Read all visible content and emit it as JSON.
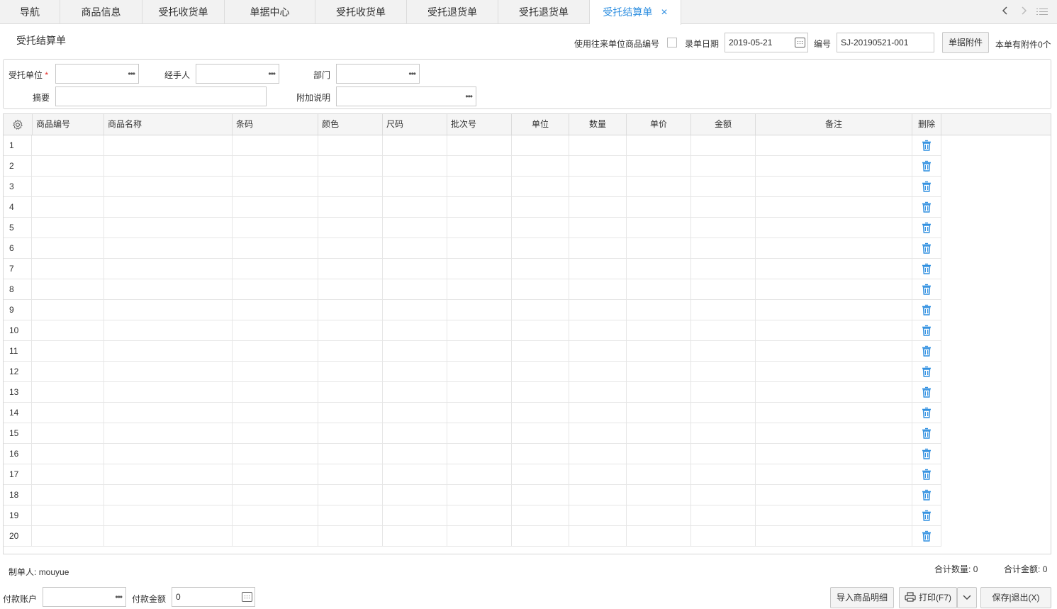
{
  "tabs": [
    {
      "label": "导航",
      "active": false
    },
    {
      "label": "商品信息",
      "active": false
    },
    {
      "label": "受托收货单",
      "active": false
    },
    {
      "label": "单据中心",
      "active": false
    },
    {
      "label": "受托收货单",
      "active": false
    },
    {
      "label": "受托退货单",
      "active": false
    },
    {
      "label": "受托退货单",
      "active": false
    },
    {
      "label": "受托结算单",
      "active": true
    }
  ],
  "tab_nav": {
    "prev_icon": "chevron-left-icon",
    "next_icon": "chevron-right-icon",
    "list_icon": "list-icon",
    "close_icon": "×"
  },
  "page_title": "受托结算单",
  "header": {
    "use_partner_code_label": "使用往来单位商品编号",
    "use_partner_code_checked": false,
    "date_label": "录单日期",
    "date_value": "2019-05-21",
    "number_label": "编号",
    "number_value": "SJ-20190521-001",
    "attachment_button": "单据附件",
    "attachment_count_text": "本单有附件0个"
  },
  "form": {
    "consignor_label": "受托单位",
    "required_mark": "*",
    "handler_label": "经手人",
    "department_label": "部门",
    "summary_label": "摘要",
    "remark_label": "附加说明",
    "consignor_value": "",
    "handler_value": "",
    "department_value": "",
    "summary_value": "",
    "remark_value": "",
    "picker_glyph": "•••"
  },
  "grid": {
    "settings_icon": "gear-icon",
    "columns": [
      "商品编号",
      "商品名称",
      "条码",
      "颜色",
      "尺码",
      "批次号",
      "单位",
      "数量",
      "单价",
      "金额",
      "备注",
      "删除"
    ],
    "row_numbers": [
      "1",
      "2",
      "3",
      "4",
      "5",
      "6",
      "7",
      "8",
      "9",
      "10",
      "11",
      "12",
      "13",
      "14",
      "15",
      "16",
      "17",
      "18",
      "19",
      "20"
    ],
    "delete_icon": "trash-icon"
  },
  "footer": {
    "creator_label": "制单人:",
    "creator_value": "mouyue",
    "total_qty_label": "合计数量:",
    "total_qty_value": "0",
    "total_amount_label": "合计金额:",
    "total_amount_value": "0",
    "pay_account_label": "付款账户",
    "pay_account_value": "",
    "pay_amount_label": "付款金额",
    "pay_amount_value": "0",
    "import_button": "导入商品明细",
    "print_button": "打印(F7)",
    "save_exit_button": "保存|退出(X)"
  },
  "colors": {
    "accent": "#2f8fe0",
    "required": "#e5322d"
  }
}
